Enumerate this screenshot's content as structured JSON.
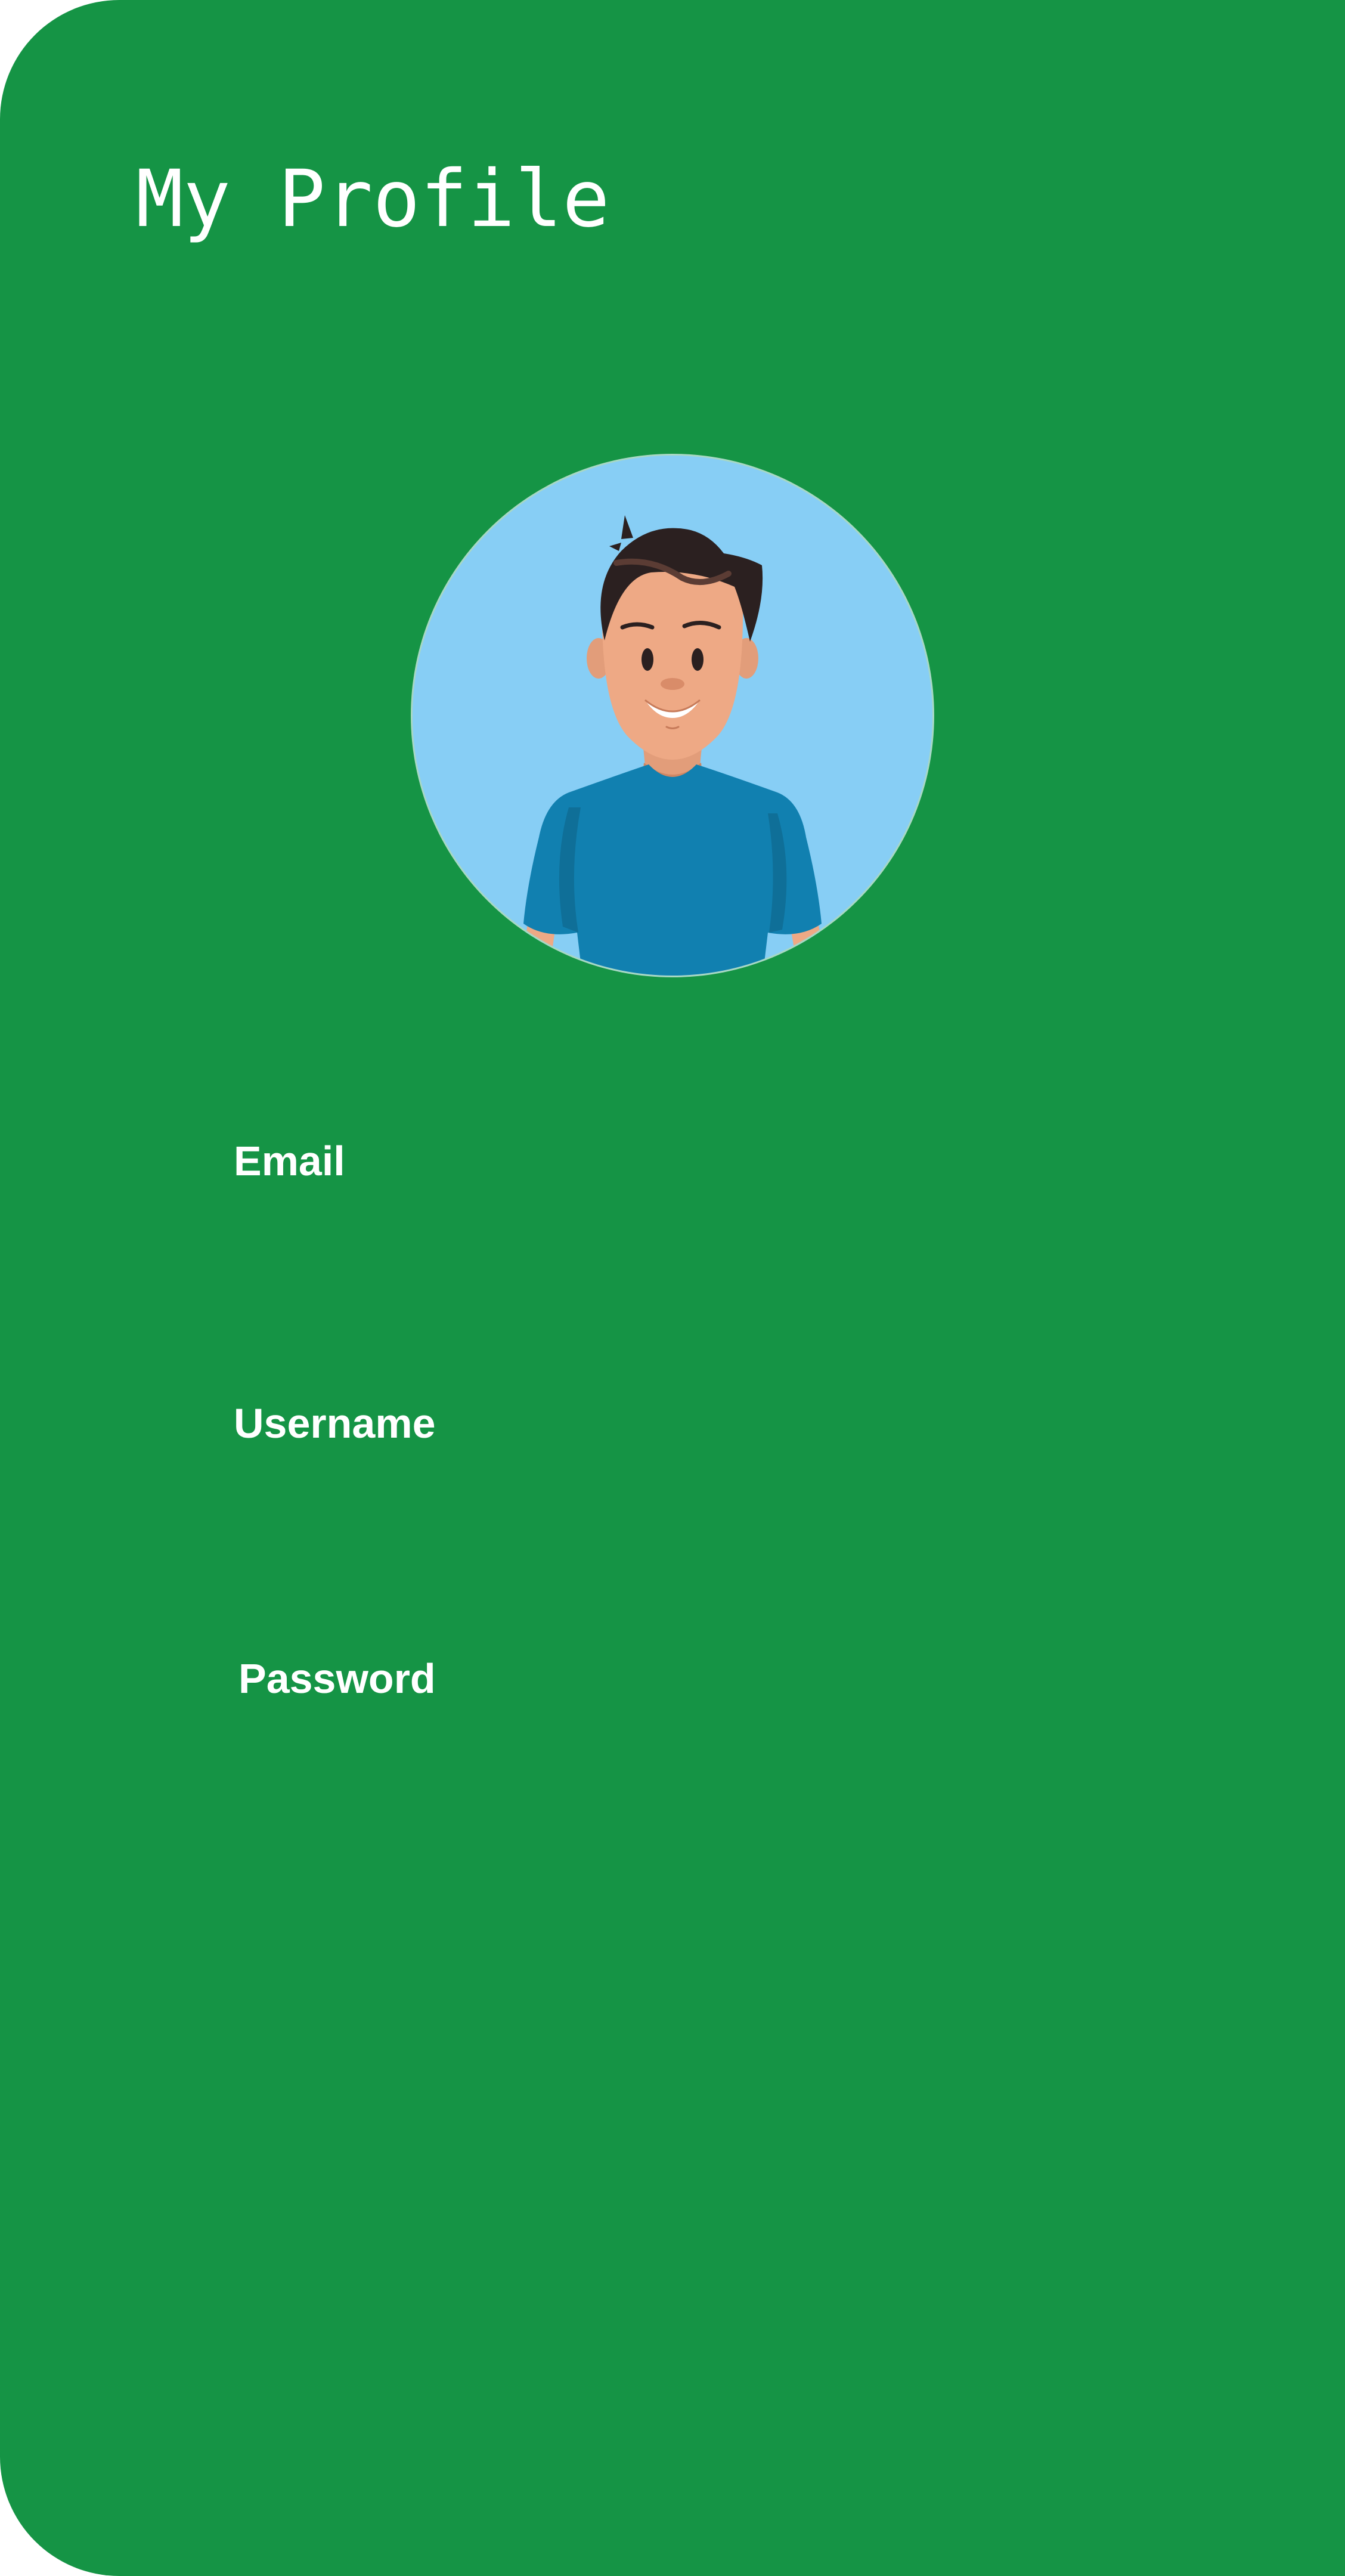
{
  "header": {
    "title": "My Profile"
  },
  "avatar": {
    "icon": "cartoon-man-avatar",
    "background_color": "#87cef5"
  },
  "form": {
    "email_label": "Email",
    "username_label": "Username",
    "password_label": "Password"
  },
  "theme": {
    "background": "#159445",
    "text": "#ffffff",
    "shirt": "#1180b0",
    "hair": "#2b2020",
    "skin": "#eea985"
  }
}
